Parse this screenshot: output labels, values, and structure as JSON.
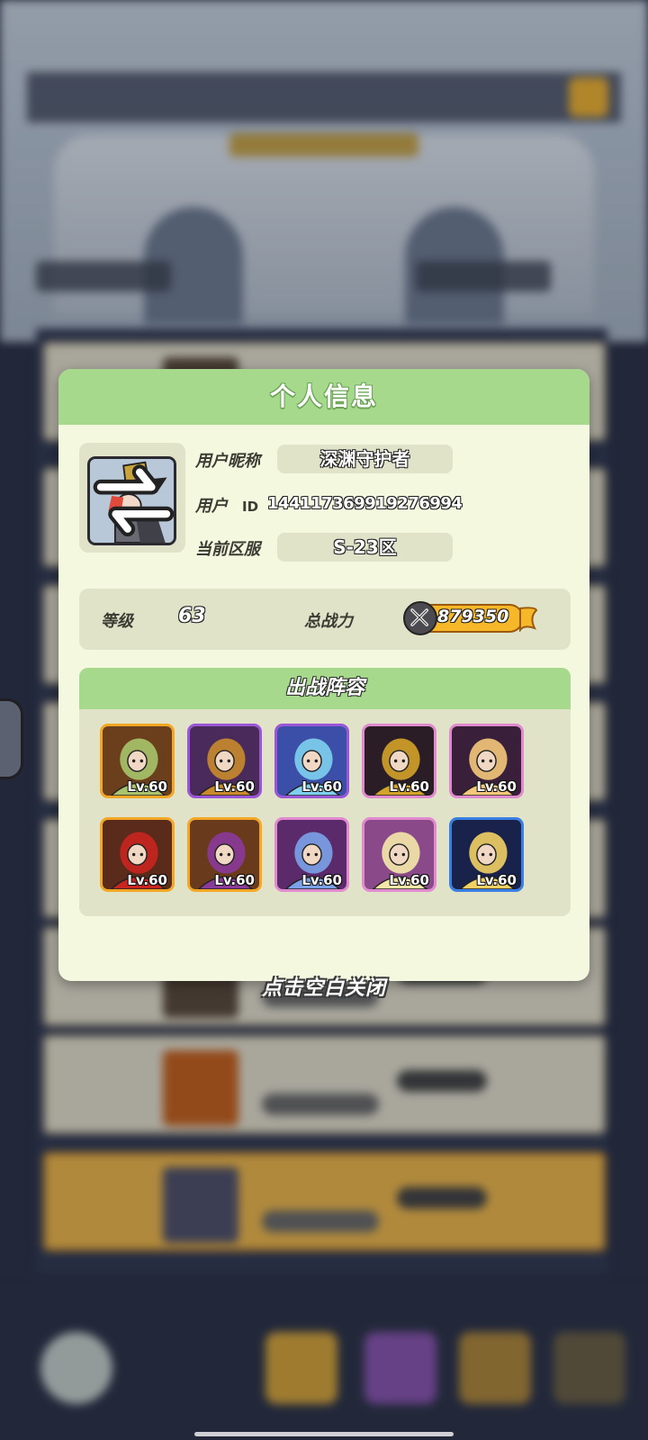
{
  "dialog": {
    "title": "个人信息",
    "profile": {
      "nickname_label": "用户昵称",
      "nickname": "深渊守护者",
      "user_label": "用户",
      "id_label": "ID",
      "user_id": "1441173699192769​94",
      "server_label": "当前区服",
      "server": "S-23区"
    },
    "stats": {
      "level_label": "等级",
      "level": "63",
      "power_label": "总战力",
      "power": "879350"
    },
    "lineup": {
      "title": "出战阵容",
      "heroes": [
        {
          "level": "Lv.60",
          "rarity": "gold",
          "art": "green-dragon-warrior",
          "colors": [
            "#6b3f1c",
            "#a9c46c"
          ]
        },
        {
          "level": "Lv.60",
          "rarity": "purple",
          "art": "horned-beast",
          "colors": [
            "#4a2a5a",
            "#c98a2c"
          ]
        },
        {
          "level": "Lv.60",
          "rarity": "purple",
          "art": "ice-shark",
          "colors": [
            "#3b4fa8",
            "#7fd0f0"
          ]
        },
        {
          "level": "Lv.60",
          "rarity": "pink",
          "art": "dark-knight",
          "colors": [
            "#2a1d25",
            "#d4a32a"
          ]
        },
        {
          "level": "Lv.60",
          "rarity": "pink",
          "art": "fire-mage",
          "colors": [
            "#3a1f3a",
            "#f4c87a"
          ]
        },
        {
          "level": "Lv.60",
          "rarity": "gold",
          "art": "red-hood",
          "colors": [
            "#5a2a1a",
            "#c8251f"
          ]
        },
        {
          "level": "Lv.60",
          "rarity": "gold",
          "art": "shadow-elf",
          "colors": [
            "#6a3a1c",
            "#8a3a9a"
          ]
        },
        {
          "level": "Lv.60",
          "rarity": "pink",
          "art": "blue-valkyrie",
          "colors": [
            "#5a2a6a",
            "#7aa2e8"
          ]
        },
        {
          "level": "Lv.60",
          "rarity": "pink",
          "art": "white-priestess",
          "colors": [
            "#8a4a8a",
            "#f4e8a8"
          ]
        },
        {
          "level": "Lv.60",
          "rarity": "blue",
          "art": "blonde-hero",
          "colors": [
            "#18224a",
            "#f2d064"
          ]
        }
      ]
    }
  },
  "close_hint": "点击空白关闭",
  "colors": {
    "panel_bg": "#f4f8df",
    "header_green": "#a6d98c",
    "inner_box": "#e0e3c8"
  }
}
